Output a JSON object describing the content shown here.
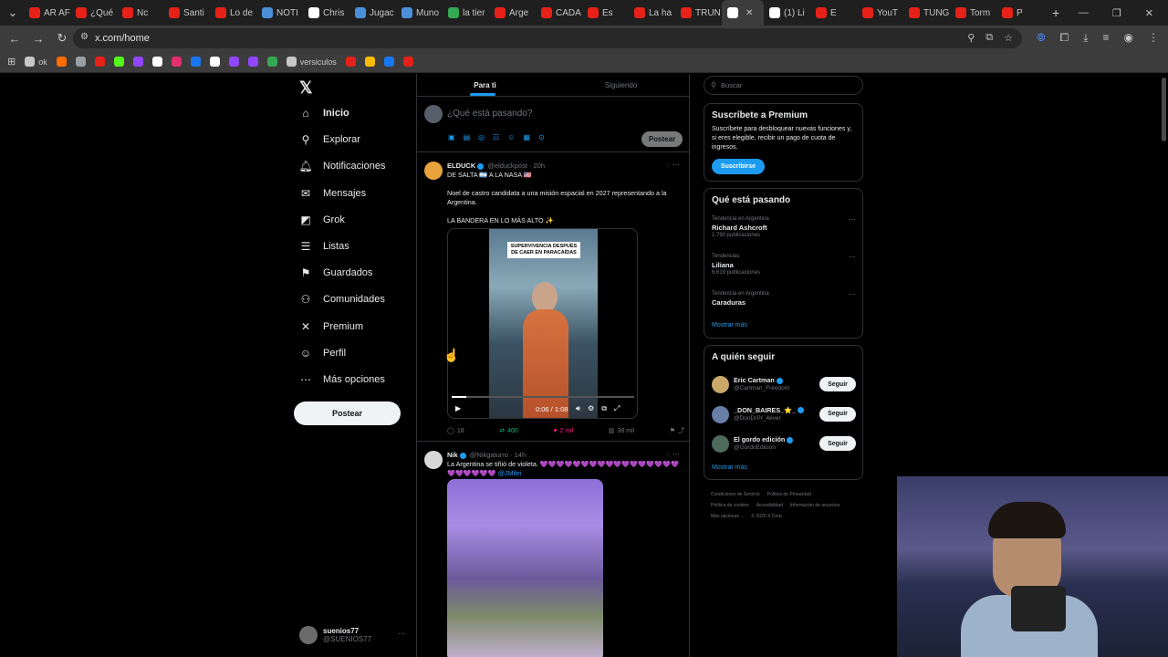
{
  "browser": {
    "tabs": [
      {
        "label": "AR AF",
        "color": "#e62117"
      },
      {
        "label": "¿Qué",
        "color": "#e62117"
      },
      {
        "label": "Nc",
        "color": "#e62117"
      },
      {
        "label": "Santi",
        "color": "#e62117"
      },
      {
        "label": "Lo de",
        "color": "#e62117"
      },
      {
        "label": "NOTI",
        "color": "#4a90d9"
      },
      {
        "label": "Chris",
        "color": "#ffffff"
      },
      {
        "label": "Jugac",
        "color": "#4a90d9"
      },
      {
        "label": "Muno",
        "color": "#4a90d9"
      },
      {
        "label": "la tier",
        "color": "#34a853"
      },
      {
        "label": "Arge",
        "color": "#e62117"
      },
      {
        "label": "CADA",
        "color": "#e62117"
      },
      {
        "label": "Es",
        "color": "#e62117"
      },
      {
        "label": "La ha",
        "color": "#e62117"
      },
      {
        "label": "TRUN",
        "color": "#e62117"
      },
      {
        "label": "",
        "color": "#ffffff",
        "active": true
      },
      {
        "label": "(1) Li",
        "color": "#ffffff"
      },
      {
        "label": "E",
        "color": "#e62117"
      },
      {
        "label": "YouT",
        "color": "#e62117"
      },
      {
        "label": "TUNG",
        "color": "#e62117"
      },
      {
        "label": "Torm",
        "color": "#e62117"
      },
      {
        "label": "P",
        "color": "#e62117"
      }
    ],
    "url": "x.com/home",
    "bookmarks": [
      {
        "label": "ok",
        "color": "#c7c7c7"
      },
      {
        "label": "",
        "color": "#ff6d00"
      },
      {
        "label": "",
        "color": "#9aa0a6"
      },
      {
        "label": "",
        "color": "#e62117"
      },
      {
        "label": "",
        "color": "#53fc18"
      },
      {
        "label": "",
        "color": "#9146ff"
      },
      {
        "label": "",
        "color": "#ffffff"
      },
      {
        "label": "",
        "color": "#e1306c"
      },
      {
        "label": "",
        "color": "#1877f2"
      },
      {
        "label": "",
        "color": "#ffffff"
      },
      {
        "label": "",
        "color": "#9146ff"
      },
      {
        "label": "",
        "color": "#9146ff"
      },
      {
        "label": "",
        "color": "#34a853"
      },
      {
        "label": "versiculos",
        "color": "#c7c7c7"
      },
      {
        "label": "",
        "color": "#e62117"
      },
      {
        "label": "",
        "color": "#fbbc04"
      },
      {
        "label": "",
        "color": "#1877f2"
      },
      {
        "label": "",
        "color": "#e62117"
      }
    ]
  },
  "nav": {
    "items": [
      {
        "label": "Inicio",
        "icon": "home-icon",
        "glyph": "⌂"
      },
      {
        "label": "Explorar",
        "icon": "search-icon",
        "glyph": "⚲"
      },
      {
        "label": "Notificaciones",
        "icon": "bell-icon",
        "glyph": "🔔︎"
      },
      {
        "label": "Mensajes",
        "icon": "mail-icon",
        "glyph": "✉"
      },
      {
        "label": "Grok",
        "icon": "grok-icon",
        "glyph": "◩"
      },
      {
        "label": "Listas",
        "icon": "list-icon",
        "glyph": "☰"
      },
      {
        "label": "Guardados",
        "icon": "bookmark-icon",
        "glyph": "⚑"
      },
      {
        "label": "Comunidades",
        "icon": "people-icon",
        "glyph": "⚇"
      },
      {
        "label": "Premium",
        "icon": "x-icon",
        "glyph": "✕"
      },
      {
        "label": "Perfil",
        "icon": "person-icon",
        "glyph": "☺"
      },
      {
        "label": "Más opciones",
        "icon": "more-icon",
        "glyph": "⋯"
      }
    ],
    "post_button": "Postear",
    "account_name": "suenios77",
    "account_handle": "@SUENIOS77"
  },
  "timeline": {
    "tab_for_you": "Para ti",
    "tab_following": "Siguiendo",
    "compose_placeholder": "¿Qué está pasando?",
    "compose_button": "Postear",
    "tweet1": {
      "name": "ELDUCK",
      "handle": "@elduckpost · 20h",
      "line1": "DE SALTA 🇦🇷 A LA NASA 🇺🇸",
      "line2": "Noel de castro candidata a una misión espacial en 2027 representando a la Argentina.",
      "line3": "LA BANDERA EN LO MÁS ALTO ✨",
      "video_caption": "SUPERVIVENCIA DESPUÉS DE CAER EN PARACAÍDAS",
      "video_time": "0:06 / 1:08",
      "video_progress": 0.08,
      "replies": "18",
      "reposts": "400",
      "likes": "2 mil",
      "views": "38 mil"
    },
    "tweet2": {
      "name": "Nik",
      "handle": "@Nikgaturro · 14h",
      "text": "La Argentina se tiñió de violeta. 💜💜💜💜💜💜💜💜💜💜💜💜💜💜💜💜💜💜💜💜💜💜💜",
      "mention": "@JMilei"
    }
  },
  "right": {
    "search_placeholder": "Buscar",
    "premium_title": "Suscríbete a Premium",
    "premium_text": "Suscríbete para desbloquear nuevas funciones y, si eres elegible, recibir un pago de cuota de ingresos.",
    "premium_button": "Suscribirse",
    "trends_title": "Qué está pasando",
    "trends": [
      {
        "context": "Tendencia en Argentina",
        "title": "Richard Ashcroft",
        "count": "1.790 publicaciones"
      },
      {
        "context": "Tendencias",
        "title": "Liliana",
        "count": "6.619 publicaciones"
      },
      {
        "context": "Tendencia en Argentina",
        "title": "Caraduras",
        "count": ""
      }
    ],
    "trends_more": "Mostrar más",
    "follow_title": "A quién seguir",
    "follow": [
      {
        "name": "Eric Cartman",
        "handle": "@Cartman_Freedom",
        "button": "Seguir",
        "color": "#c9a86a"
      },
      {
        "name": "_DON_BAIRES_⭐_",
        "handle": "@DonDrPr_4ever",
        "button": "Seguir",
        "color": "#6a7fa6"
      },
      {
        "name": "El gordo edición",
        "handle": "@GordoEdicion",
        "button": "Seguir",
        "color": "#4d6a5a"
      }
    ],
    "follow_more": "Mostrar más",
    "footer": [
      "Condiciones de Servicio",
      "Política de Privacidad",
      "Política de cookies",
      "Accesibilidad",
      "Información de anuncios",
      "Más opciones ...",
      "© 2025 X Corp."
    ]
  }
}
